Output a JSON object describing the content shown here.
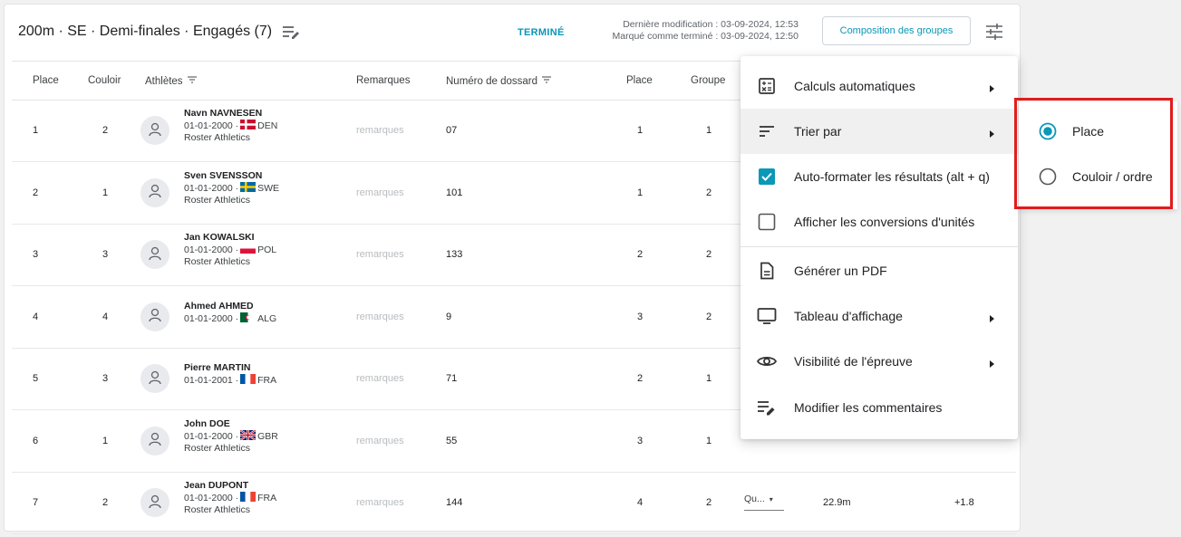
{
  "header": {
    "title": "200m · SE · Demi-finales · Engagés (7)",
    "status": "TERMINÉ",
    "last_modified": "Dernière modification : 03-09-2024, 12:53",
    "marked_done": "Marqué comme terminé : 03-09-2024, 12:50",
    "groups_button": "Composition des groupes"
  },
  "columns": {
    "place": "Place",
    "lane": "Couloir",
    "athletes": "Athlètes",
    "remarks": "Remarques",
    "bib": "Numéro de dossard",
    "place2": "Place",
    "group": "Groupe"
  },
  "rows": [
    {
      "place": "1",
      "lane": "2",
      "name": "Navn NAVNESEN",
      "dob": "01-01-2000 ·",
      "country": "DEN",
      "club": "Roster Athletics",
      "remarks": "remarques",
      "bib": "07",
      "place2": "1",
      "group": "1"
    },
    {
      "place": "2",
      "lane": "1",
      "name": "Sven SVENSSON",
      "dob": "01-01-2000 ·",
      "country": "SWE",
      "club": "Roster Athletics",
      "remarks": "remarques",
      "bib": "101",
      "place2": "1",
      "group": "2"
    },
    {
      "place": "3",
      "lane": "3",
      "name": "Jan KOWALSKI",
      "dob": "01-01-2000 ·",
      "country": "POL",
      "club": "Roster Athletics",
      "remarks": "remarques",
      "bib": "133",
      "place2": "2",
      "group": "2"
    },
    {
      "place": "4",
      "lane": "4",
      "name": "Ahmed AHMED",
      "dob": "01-01-2000 ·",
      "country": "ALG",
      "club": "",
      "remarks": "remarques",
      "bib": "9",
      "place2": "3",
      "group": "2"
    },
    {
      "place": "5",
      "lane": "3",
      "name": "Pierre MARTIN",
      "dob": "01-01-2001 ·",
      "country": "FRA",
      "club": "",
      "remarks": "remarques",
      "bib": "71",
      "place2": "2",
      "group": "1"
    },
    {
      "place": "6",
      "lane": "1",
      "name": "John DOE",
      "dob": "01-01-2000 ·",
      "country": "GBR",
      "club": "Roster Athletics",
      "remarks": "remarques",
      "bib": "55",
      "place2": "3",
      "group": "1"
    },
    {
      "place": "7",
      "lane": "2",
      "name": "Jean DUPONT",
      "dob": "01-01-2000 ·",
      "country": "FRA",
      "club": "Roster Athletics",
      "remarks": "remarques",
      "bib": "144",
      "place2": "4",
      "group": "2",
      "select": "Qu...",
      "result": "22.9m",
      "wind": "+1.8"
    }
  ],
  "menu": {
    "items": [
      {
        "label": "Calculs automatiques",
        "icon": "calculator-icon"
      },
      {
        "label": "Trier par",
        "icon": "sort-icon"
      },
      {
        "label": "Auto-formater les résultats (alt + q)",
        "icon": "checkbox-checked-icon"
      },
      {
        "label": "Afficher les conversions d'unités",
        "icon": "checkbox-empty-icon"
      },
      {
        "label": "Générer un PDF",
        "icon": "pdf-icon"
      },
      {
        "label": "Tableau d'affichage",
        "icon": "monitor-icon"
      },
      {
        "label": "Visibilité de l'épreuve",
        "icon": "eye-icon"
      },
      {
        "label": "Modifier les commentaires",
        "icon": "edit-comments-icon"
      }
    ]
  },
  "submenu": {
    "items": [
      {
        "label": "Place",
        "selected": true
      },
      {
        "label": "Couloir / ordre",
        "selected": false
      }
    ]
  },
  "colors": {
    "accent": "#0a97b8",
    "highlight": "#e21c1c"
  }
}
